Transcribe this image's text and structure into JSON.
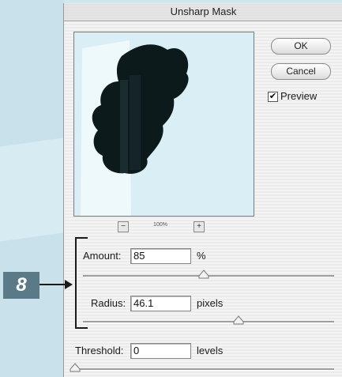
{
  "dialog": {
    "title": "Unsharp Mask",
    "ok_label": "OK",
    "cancel_label": "Cancel",
    "preview_label": "Preview",
    "preview_checked": true,
    "zoom": {
      "minus_glyph": "−",
      "plus_glyph": "+",
      "level": "100%"
    },
    "amount": {
      "label": "Amount:",
      "value": "85",
      "unit": "%",
      "slider_fraction": 0.48
    },
    "radius": {
      "label": "Radius:",
      "value": "46.1",
      "unit": "pixels",
      "slider_fraction": 0.62
    },
    "threshold": {
      "label": "Threshold:",
      "value": "0",
      "unit": "levels",
      "slider_fraction": 0.0
    }
  },
  "annotation": {
    "step_number": "8"
  },
  "colors": {
    "preview_bg": "#d9eff5",
    "blob": "#0d1a1c",
    "badge": "#5a7a88",
    "page_bg": "#cfe6ee"
  },
  "icons": [
    "zoom-out-icon",
    "zoom-in-icon",
    "checkmark-icon",
    "slider-thumb-icon",
    "arrow-right-icon"
  ]
}
